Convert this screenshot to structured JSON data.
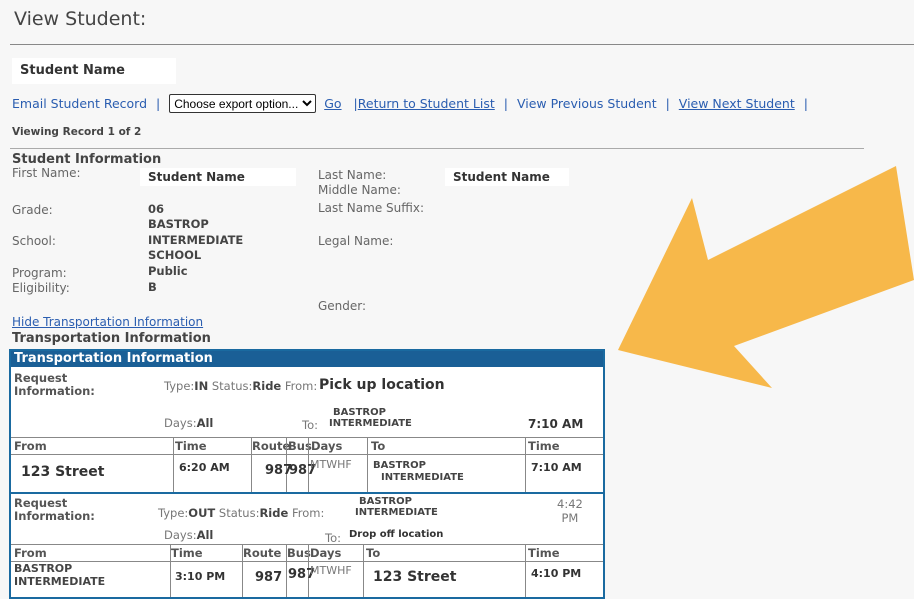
{
  "page": {
    "title": "View Student:",
    "student_name_header": "Student Name"
  },
  "nav": {
    "email_record": "Email Student Record",
    "export_select": "Choose export option...",
    "go": "Go",
    "return_list": "Return to Student List",
    "view_previous": "View Previous Student",
    "view_next": "View Next Student"
  },
  "record_info": "Viewing Record 1 of 2",
  "student_info": {
    "heading": "Student Information",
    "first_name_label": "First Name:",
    "first_name": "Student Name",
    "last_name_label": "Last Name:",
    "last_name": "Student Name",
    "middle_name_label": "Middle Name:",
    "grade_label": "Grade:",
    "grade": "06",
    "last_name_suffix_label": "Last Name Suffix:",
    "school_label": "School:",
    "school": [
      "BASTROP",
      "INTERMEDIATE",
      "SCHOOL"
    ],
    "legal_name_label": "Legal Name:",
    "program_label": "Program:",
    "program": "Public",
    "eligibility_label": "Eligibility:",
    "eligibility": "B",
    "gender_label": "Gender:"
  },
  "transport": {
    "hide_link": "Hide Transportation Information",
    "heading": "Transportation Information",
    "panel_title": "Transportation Information",
    "requests": [
      {
        "label": [
          "Request",
          "Information:"
        ],
        "type_label": "Type:",
        "type": "IN",
        "status_label": "Status:",
        "status": "Ride",
        "from_label": "From:",
        "from": "Pick up location",
        "days_label": "Days:",
        "days": "All",
        "to_label": "To:",
        "to": [
          "BASTROP",
          "INTERMEDIATE"
        ],
        "time": "7:10 AM",
        "columns": [
          "From",
          "Time",
          "Route",
          "Bus",
          "Days",
          "To",
          "Time"
        ],
        "row": {
          "from": "123 Street",
          "time": "6:20 AM",
          "route": "987",
          "bus": "987",
          "days": "MTWHF",
          "to": [
            "BASTROP",
            "INTERMEDIATE"
          ],
          "arrive": "7:10 AM"
        }
      },
      {
        "label": [
          "Request",
          "Information:"
        ],
        "type_label": "Type:",
        "type": "OUT",
        "status_label": "Status:",
        "status": "Ride",
        "from_label": "From:",
        "from": [
          "BASTROP",
          "INTERMEDIATE"
        ],
        "days_label": "Days:",
        "days": "All",
        "to_label": "To:",
        "to": "Drop off location",
        "time": [
          "4:42",
          "PM"
        ],
        "columns": [
          "From",
          "Time",
          "Route",
          "Bus",
          "Days",
          "To",
          "Time"
        ],
        "row": {
          "from": [
            "BASTROP",
            "INTERMEDIATE"
          ],
          "time": "3:10 PM",
          "route": "987",
          "bus": "987",
          "days": "MTWHF",
          "to": "123 Street",
          "arrive": "4:10 PM"
        }
      }
    ]
  },
  "colors": {
    "accent_arrow": "#f7b84a",
    "panel_header": "#1a5f96",
    "link": "#2a5db0"
  },
  "icons": {
    "arrow": "big-arrow-annotation-icon",
    "dropdown": "chevron-down-icon"
  }
}
